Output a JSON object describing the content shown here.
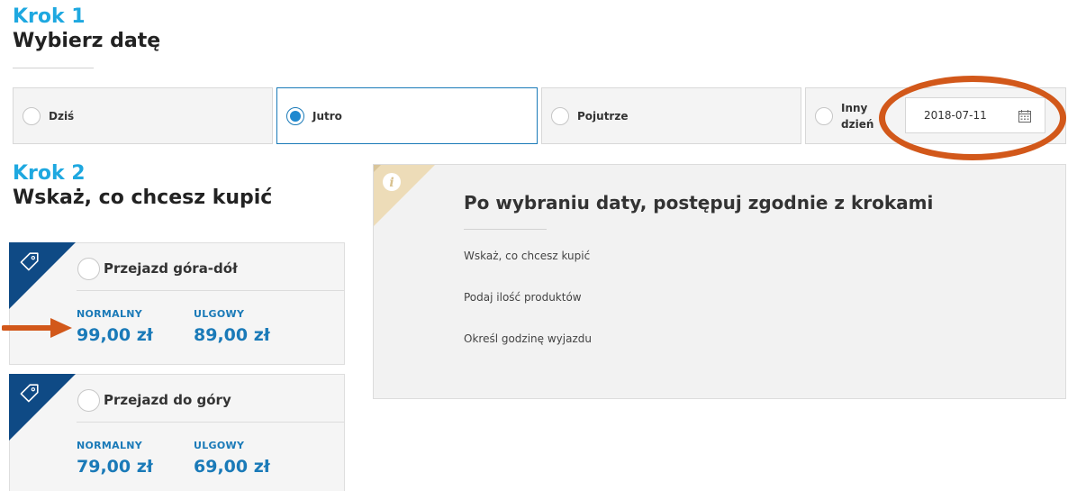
{
  "step1": {
    "label": "Krok 1",
    "title": "Wybierz datę"
  },
  "date_options": [
    {
      "label": "Dziś",
      "selected": false
    },
    {
      "label": "Jutro",
      "selected": true
    },
    {
      "label": "Pojutrze",
      "selected": false
    },
    {
      "label_line1": "Inny",
      "label_line2": "dzień",
      "selected": false
    }
  ],
  "date_input": {
    "value": "2018-07-11",
    "icon": "calendar-icon"
  },
  "step2": {
    "label": "Krok 2",
    "title": "Wskaż, co chcesz kupić"
  },
  "products": [
    {
      "name": "Przejazd góra-dół",
      "normal_label": "NORMALNY",
      "normal_price": "99,00 zł",
      "reduced_label": "ULGOWY",
      "reduced_price": "89,00 zł"
    },
    {
      "name": "Przejazd do góry",
      "normal_label": "NORMALNY",
      "normal_price": "79,00 zł",
      "reduced_label": "ULGOWY",
      "reduced_price": "69,00 zł"
    }
  ],
  "info": {
    "icon": "info-icon",
    "title": "Po wybraniu daty, postępuj zgodnie z krokami",
    "steps": [
      "Wskaż, co chcesz kupić",
      "Podaj ilość produktów",
      "Określ godzinę wyjazdu"
    ]
  },
  "colors": {
    "accent_blue": "#1ea8e0",
    "price_blue": "#1a7ab8",
    "ribbon_navy": "#0f4a85",
    "annotation_orange": "#d2581a",
    "info_ribbon": "#eddcb8"
  }
}
